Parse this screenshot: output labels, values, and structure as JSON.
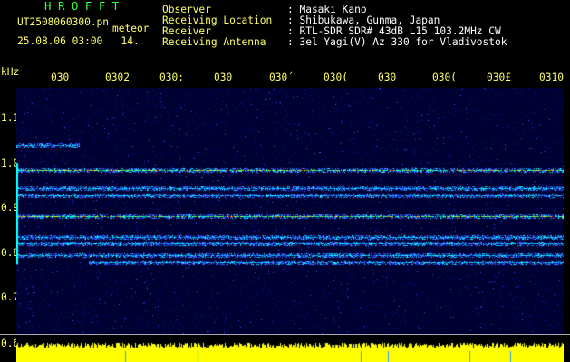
{
  "header": {
    "brand": "HROFFT",
    "filename": "UT2508060300.pn",
    "meteor_label": "meteor",
    "datetime": "25.08.06 03:00",
    "count": "14.",
    "labels": [
      "Observer",
      "Receiving Location",
      "Receiver",
      "Receiving Antenna"
    ],
    "values": [
      ": Masaki Kano",
      ": Shibukawa, Gunma, Japan",
      ": RTL-SDR SDR# 43dB L15 103.2MHz CW",
      ": 3el Yagi(V) Az 330 for Vladivostok"
    ]
  },
  "axis": {
    "unit": "kHz",
    "time_ticks": [
      "030",
      "0302",
      "030:",
      "030",
      "030́",
      "030(",
      "030",
      "030(",
      "030£",
      "0310"
    ],
    "freq_labels": [
      "1.1",
      "1.0",
      "0.9",
      "0.8",
      "0.7",
      "0.6"
    ],
    "freq_range": [
      0.6,
      1.1
    ]
  },
  "spectrogram": {
    "bands_khz": [
      1.04,
      0.985,
      0.945,
      0.93,
      0.885,
      0.84,
      0.825,
      0.8,
      0.785
    ],
    "background_color": "#000033",
    "noise_color": "#2f5cff",
    "peak_colors": [
      "#00ffff",
      "#66ff33",
      "#ffff00",
      "#ff3300"
    ]
  },
  "signal_panel": {
    "bar_color": "#ffff00",
    "marker_color": "#3399ff"
  }
}
